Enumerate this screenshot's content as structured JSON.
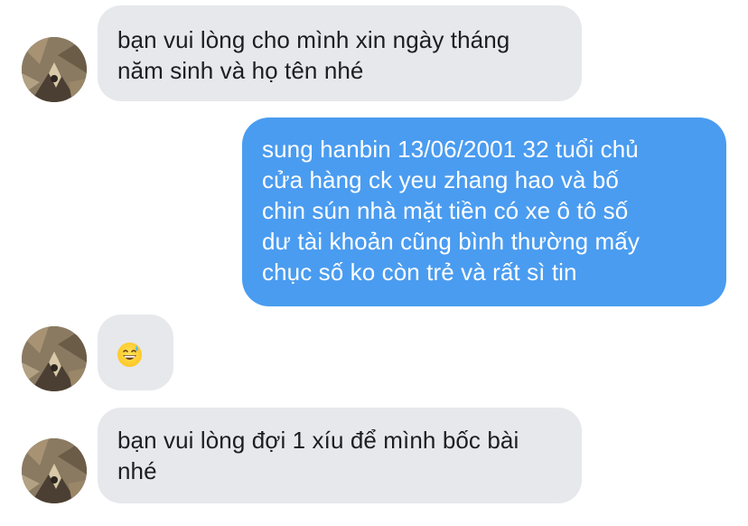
{
  "messages": [
    {
      "sender": "other",
      "lines": [
        "bạn vui lòng cho mình xin ngày tháng",
        "năm sinh và họ tên nhé"
      ]
    },
    {
      "sender": "me",
      "lines": [
        "sung hanbin 13/06/2001 32 tuổi chủ",
        "cửa hàng ck yeu zhang hao và bố",
        "chin sún nhà mặt tiền có xe ô tô số",
        "dư tài khoản cũng bình thường mấy",
        "chục số ko còn trẻ và rất sì tin"
      ]
    },
    {
      "sender": "other",
      "emoji": "grinning-face-with-sweat"
    },
    {
      "sender": "other",
      "lines": [
        "bạn vui lòng đợi 1 xíu để mình bốc bài",
        "nhé"
      ]
    }
  ],
  "colors": {
    "incoming_bubble": "#e6e8ec",
    "outgoing_bubble": "#4a9cf0",
    "incoming_text": "#1c1e21",
    "outgoing_text": "#ffffff"
  }
}
